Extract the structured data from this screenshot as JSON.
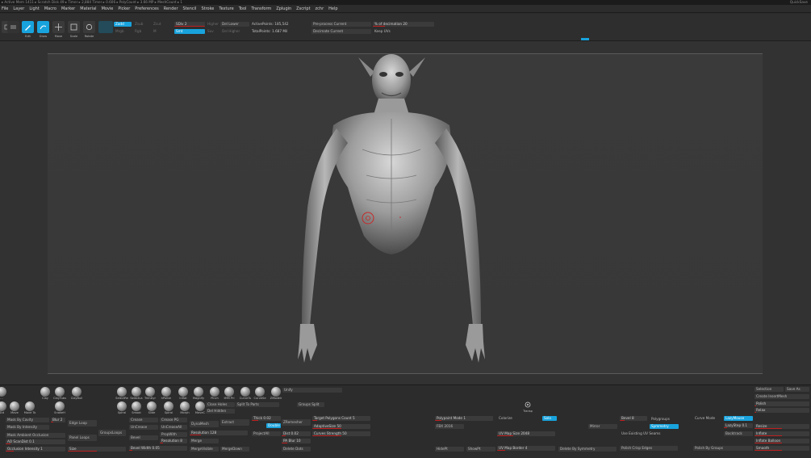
{
  "status_bar": {
    "left_text": "▸ Active Mem 1411 ▸ Scratch Disk 49 ▸ Timer ▸ 2,884 Timer ▸ 0.606 ▸ PolyCount ▸ 3.66 MP ▸ MeshCount ▸ 1",
    "right_text": "QuickSave"
  },
  "menu": [
    "File",
    "Layer",
    "Light",
    "Macro",
    "Marker",
    "Material",
    "Movie",
    "Picker",
    "Preferences",
    "Render",
    "Stencil",
    "Stroke",
    "Texture",
    "Tool",
    "Transform",
    "Zplugin",
    "Zscript",
    "zchr",
    "Help"
  ],
  "shelf": {
    "tools": [
      {
        "label": "",
        "name": "home-page-icon"
      },
      {
        "label": "",
        "name": "lightbox-icon"
      },
      {
        "label": "Edit",
        "name": "edit-icon"
      },
      {
        "label": "Draw",
        "name": "draw-icon"
      },
      {
        "label": "Move",
        "name": "move-icon"
      },
      {
        "label": "Scale",
        "name": "scale-icon"
      },
      {
        "label": "Rotate",
        "name": "rotate-icon"
      }
    ],
    "zadd": "Zadd",
    "zsub": "Zsub",
    "zcut": "Zcut",
    "mrgb": "Mrgb",
    "rgb": "Rgb",
    "m": "M",
    "sdiv": "SDiv 2",
    "higher_res": "Higher Res",
    "lower_res": "Lower Res",
    "del_lower": "Del Lower",
    "del_higher": "Del Higher",
    "smt": "Smt",
    "suv": "Suv",
    "active_points": "ActivePoints: 185,542",
    "total_points": "TotalPoints: 1.687 Mil",
    "preprocess": "Pre-process Current",
    "decimate": "Decimate Current",
    "pct_decimation": "% of decimation 20",
    "keep_uvs": "Keep UVs"
  },
  "bottom": {
    "brushes_row1": [
      "...",
      "Clay",
      "ClayTubs",
      "ClayBuil",
      "SelectRe",
      "SelectLa",
      "TrimDyr",
      "hPolish",
      "Inflat",
      "Magnify",
      "Pinch",
      "IMM Pri",
      "CurveTu",
      "CurveSe",
      "ZModelr"
    ],
    "brushes_row2": [
      "Std",
      "Move",
      "Move To",
      "SnakeH",
      "Spiral",
      "Smoot",
      "Slide",
      "Spiral",
      "Morph",
      "MoveC"
    ],
    "mask_col": [
      "Mask By Cavity",
      "Mask By Intensity",
      "Mask Ambient Occlusion",
      "AO ScanDist 0.1",
      "Occlusion Intensity 1"
    ],
    "blur": "Blur 2",
    "edge_loop": "Edge Loop",
    "panel_loops": "Panel Loops",
    "groups_loops": "GroupsLoops",
    "size": "Size",
    "crease_col": [
      "Crease",
      "UnCrease",
      "UnCreaseAll",
      "Bevel",
      "Bevel Width 0.05"
    ],
    "crease_pg": "Crease PG",
    "uncrease_pg": "UnCreasePG",
    "propwith": "PropWith",
    "resolution_b": "Resolution 8",
    "dynamesh": "DynaMesh",
    "resolution": "Resolution 128",
    "merge": "Merge",
    "merge_visible": "MergeVisible",
    "merge_down": "MergeDown",
    "extract": "Extract",
    "close_holes": "Close Holes",
    "del_hidden": "Del Hidden",
    "split_to_parts": "Split To Parts",
    "thick": "Thick 0.02",
    "double": "Double",
    "project_all": "ProjectAll",
    "zremesher": "ZRemesher",
    "dist": "Dist 0.02",
    "pa_blur": "PA Blur 10",
    "delete_dots": "Delete Dots",
    "groups_split": "Groups Split",
    "target_poly": "Target Polygons Count 5",
    "adaptive_size": "AdaptiveSize 50",
    "curves_strength": "Curves Strength 50",
    "unify": "Unify",
    "polypaint_mode": "Polypaint Mode 1",
    "fbx_2016": "FBX 2016",
    "export_file": "Export",
    "uv_map_size": "UV Map Size 2048",
    "uv_map_border": "UV Map Border 4",
    "hidepnt": "HidePt",
    "showpt": "ShowPt",
    "colorize": "Colorize",
    "transp": "Transp",
    "solo": "Solo",
    "xyz": "Xyz",
    "mirror": "Mirror",
    "delete_by_symmetry": "Delete By Symmetry",
    "bevel_b": "Bevel 8",
    "polygroups": "Polygroups",
    "symmetry": "Symmetry",
    "use_existing_uv": "Use Existing UV Seams",
    "polish_crisp": "Polish Crisp Edges",
    "curve_mode": "Curve Mode",
    "lazymouse": "LazyMouse",
    "lazystep": "LazyStep 0.1",
    "backtrack": "Backtrack",
    "polish_groups": "Polish By Groups",
    "selection": "Selection",
    "save_as": "Save As",
    "create_insert": "Create InsertMesh",
    "polish": "Polish",
    "relax": "Relax",
    "resize": "Resize",
    "inflate": "Inflate",
    "inflate_balloon": "Inflate Balloon",
    "smooth": "Smooth"
  },
  "accent_color": "#18a3dd",
  "slider_color": "#c02020"
}
